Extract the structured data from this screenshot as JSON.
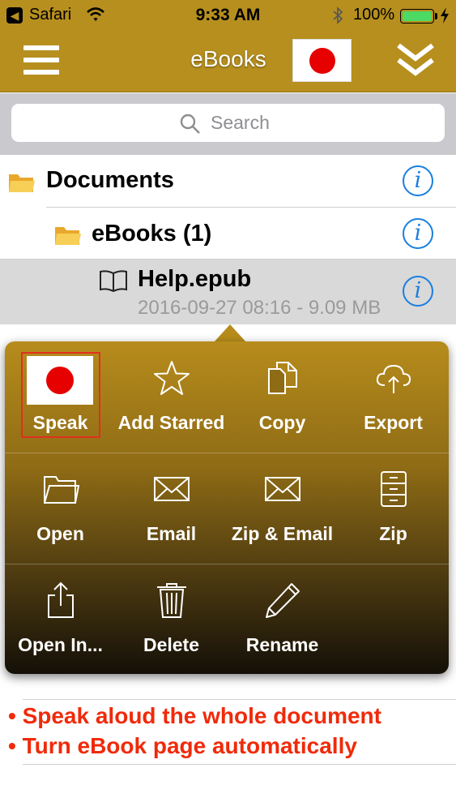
{
  "status_bar": {
    "carrier": "Safari",
    "time": "9:33 AM",
    "battery": "100%",
    "back_glyph": "◀"
  },
  "nav": {
    "title": "eBooks",
    "icons": [
      "menu-icon",
      "flag-japan-icon",
      "double-chevron-down-icon"
    ]
  },
  "search": {
    "placeholder": "Search"
  },
  "list": {
    "rows": [
      {
        "label": "Documents",
        "icon": "folder-icon",
        "info": "i"
      },
      {
        "label": "eBooks (1)",
        "icon": "folder-icon",
        "info": "i"
      },
      {
        "label": "Help.epub",
        "meta": "2016-09-27 08:16 - 9.09 MB",
        "icon": "book-icon",
        "info": "i",
        "selected": true
      }
    ]
  },
  "popover": {
    "actions": [
      {
        "label": "Speak",
        "icon": "flag-japan-icon",
        "highlighted": true
      },
      {
        "label": "Add Starred",
        "icon": "star-icon"
      },
      {
        "label": "Copy",
        "icon": "copy-icon"
      },
      {
        "label": "Export",
        "icon": "cloud-upload-icon"
      },
      {
        "label": "Open",
        "icon": "folder-open-icon"
      },
      {
        "label": "Email",
        "icon": "envelope-icon"
      },
      {
        "label": "Zip & Email",
        "icon": "envelope-icon"
      },
      {
        "label": "Zip",
        "icon": "file-cabinet-icon"
      },
      {
        "label": "Open In...",
        "icon": "share-icon"
      },
      {
        "label": "Delete",
        "icon": "trash-icon"
      },
      {
        "label": "Rename",
        "icon": "pencil-icon"
      }
    ]
  },
  "captions": [
    "• Speak aloud the whole document",
    "• Turn eBook page automatically"
  ],
  "colors": {
    "bar": "#b68f1e",
    "info_blue": "#1a7fe0",
    "caption_red": "#f02a0a",
    "flag_red": "#e60000"
  }
}
